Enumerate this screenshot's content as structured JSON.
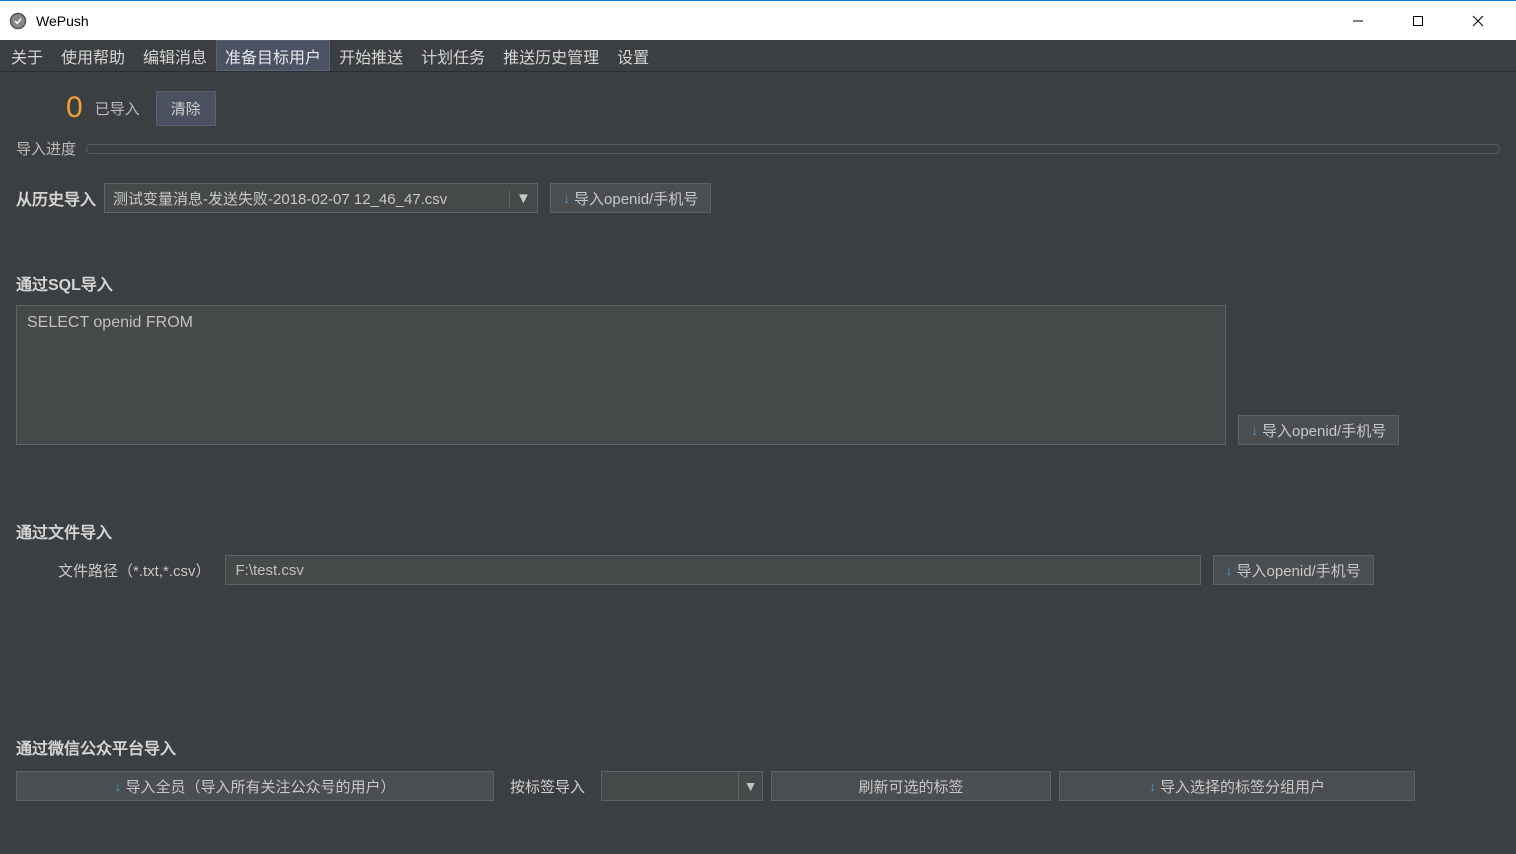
{
  "window": {
    "title": "WePush"
  },
  "tabs": {
    "about": "关于",
    "help": "使用帮助",
    "edit_message": "编辑消息",
    "prepare_users": "准备目标用户",
    "start_push": "开始推送",
    "scheduled_tasks": "计划任务",
    "push_history": "推送历史管理",
    "settings": "设置"
  },
  "imported": {
    "count": "0",
    "label": "已导入",
    "clear_btn": "清除"
  },
  "progress": {
    "label": "导入进度"
  },
  "history_import": {
    "label": "从历史导入",
    "selected": "测试变量消息-发送失败-2018-02-07 12_46_47.csv",
    "import_btn": "导入openid/手机号"
  },
  "sql_import": {
    "title": "通过SQL导入",
    "sql_value": "SELECT openid FROM",
    "import_btn": "导入openid/手机号"
  },
  "file_import": {
    "title": "通过文件导入",
    "path_label": "文件路径（*.txt,*.csv）",
    "path_value": "F:\\test.csv",
    "import_btn": "导入openid/手机号"
  },
  "wechat_import": {
    "title": "通过微信公众平台导入",
    "import_all_btn": "导入全员（导入所有关注公众号的用户）",
    "by_tag_label": "按标签导入",
    "refresh_tags_btn": "刷新可选的标签",
    "import_by_tag_btn": "导入选择的标签分组用户"
  }
}
